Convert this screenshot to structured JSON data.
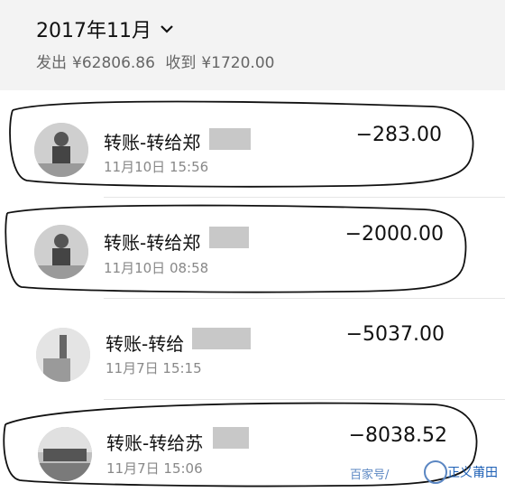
{
  "header": {
    "month": "2017年11月",
    "chevron_icon": "chevron-down-icon",
    "out_label": "发出",
    "out_amount": "¥62806.86",
    "in_label": "收到",
    "in_amount": "¥1720.00"
  },
  "transactions": [
    {
      "title": "转账-转给郑",
      "time": "11月10日 15:56",
      "amount": "−283.00",
      "avatar": "person-photo-avatar"
    },
    {
      "title": "转账-转给郑",
      "time": "11月10日 08:58",
      "amount": "−2000.00",
      "avatar": "person-photo-avatar"
    },
    {
      "title": "转账-转给",
      "time": "11月7日 15:15",
      "amount": "−5037.00",
      "avatar": "statue-photo-avatar"
    },
    {
      "title": "转账-转给苏",
      "time": "11月7日 15:06",
      "amount": "−8038.52",
      "avatar": "beach-photo-avatar"
    }
  ],
  "watermark": {
    "left": "百家号/",
    "right": "正义莆田"
  },
  "colors": {
    "header_bg": "#f3f3f3",
    "redaction": "#c8c8c8",
    "watermark": "#1c5fb5"
  }
}
